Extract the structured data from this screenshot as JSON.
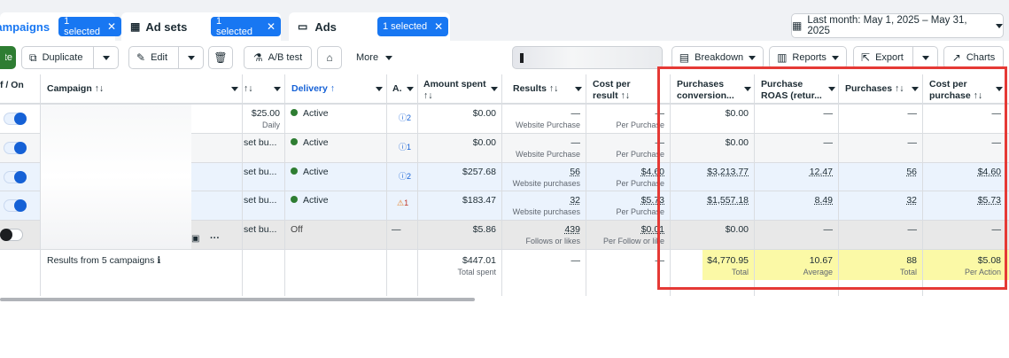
{
  "tabs": {
    "campaigns": {
      "label": "Campaigns",
      "selected": "1 selected"
    },
    "adsets": {
      "label": "Ad sets",
      "selected": "1 selected"
    },
    "ads": {
      "label": "Ads",
      "selected": "1 selected"
    },
    "date_range": "Last month: May 1, 2025 – May 31, 2025"
  },
  "toolbar": {
    "create": "Create",
    "duplicate": "Duplicate",
    "edit": "Edit",
    "ab_test": "A/B test",
    "more": "More",
    "breakdown": "Breakdown",
    "reports": "Reports",
    "export": "Export",
    "charts": "Charts"
  },
  "headers": {
    "onoff": "f / On",
    "campaign": "Campaign ↑↓",
    "budget": "↑↓",
    "delivery": "Delivery ↑",
    "attribution": "A.",
    "amount_spent_1": "Amount spent",
    "amount_spent_2": "↑↓",
    "results": "Results ↑↓",
    "cpr_1": "Cost per",
    "cpr_2": "result ↑↓",
    "pcv_1": "Purchases",
    "pcv_2": "conversion...",
    "roas_1": "Purchase",
    "roas_2": "ROAS (retur...",
    "purchases": "Purchases ↑↓",
    "cpp_1": "Cost per",
    "cpp_2": "purchase ↑↓"
  },
  "rows": [
    {
      "toggle": "on",
      "budget": "$25.00",
      "budget_sub": "Daily",
      "delivery": "Active",
      "attr": "2",
      "attr_icon": "info",
      "spent": "$0.00",
      "results": "—",
      "results_sub": "Website Purchase",
      "cpr": "—",
      "cpr_sub": "Per Purchase",
      "pcv": "$0.00",
      "roas": "—",
      "purchases": "—",
      "cpp": "—"
    },
    {
      "toggle": "on",
      "budget": "set bu...",
      "budget_sub": "",
      "delivery": "Active",
      "attr": "1",
      "attr_icon": "info",
      "spent": "$0.00",
      "results": "—",
      "results_sub": "Website Purchase",
      "cpr": "—",
      "cpr_sub": "Per Purchase",
      "pcv": "$0.00",
      "roas": "—",
      "purchases": "—",
      "cpp": "—"
    },
    {
      "toggle": "on",
      "budget": "set bu...",
      "budget_sub": "",
      "delivery": "Active",
      "attr": "2",
      "attr_icon": "info",
      "spent": "$257.68",
      "results": "56",
      "results_sub": "Website purchases",
      "cpr": "$4.60",
      "cpr_sub": "Per Purchase",
      "pcv": "$3,213.77",
      "roas": "12.47",
      "purchases": "56",
      "cpp": "$4.60"
    },
    {
      "toggle": "on",
      "budget": "set bu...",
      "budget_sub": "",
      "delivery": "Active",
      "attr": "1",
      "attr_icon": "warning",
      "spent": "$183.47",
      "results": "32",
      "results_sub": "Website purchases",
      "cpr": "$5.73",
      "cpr_sub": "Per Purchase",
      "pcv": "$1,557.18",
      "roas": "8.49",
      "purchases": "32",
      "cpp": "$5.73"
    },
    {
      "toggle": "off",
      "budget": "set bu...",
      "budget_sub": "",
      "delivery": "Off",
      "attr": "—",
      "attr_icon": "none",
      "spent": "$5.86",
      "results": "439",
      "results_sub": "Follows or likes",
      "cpr": "$0.01",
      "cpr_sub": "Per Follow or like",
      "pcv": "$0.00",
      "roas": "—",
      "purchases": "—",
      "cpp": "—"
    }
  ],
  "totals": {
    "label": "Results from 5 campaigns",
    "spent": "$447.01",
    "spent_sub": "Total spent",
    "results": "—",
    "cpr": "—",
    "pcv": "$4,770.95",
    "pcv_sub": "Total",
    "roas": "10.67",
    "roas_sub": "Average",
    "purchases": "88",
    "purchases_sub": "Total",
    "cpp": "$5.08",
    "cpp_sub": "Per Action"
  },
  "colors": {
    "accent": "#1877f2",
    "highlight_border": "#e53935",
    "totals_highlight": "#fbf9a6",
    "active_dot": "#2e7d32"
  }
}
